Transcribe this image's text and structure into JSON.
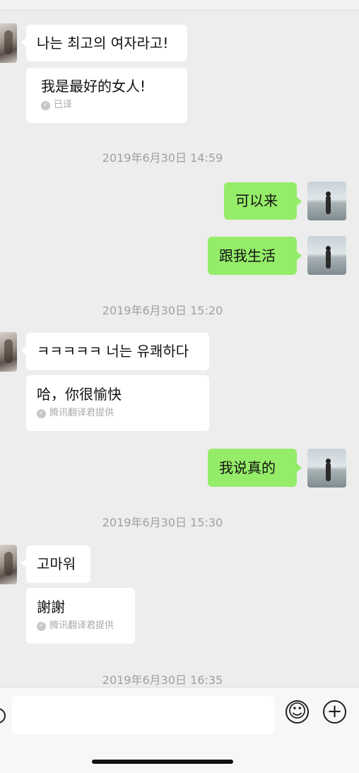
{
  "messages": [
    {
      "side": "left",
      "text": "나는 최고의 여자라고!"
    },
    {
      "side": "left",
      "text": "我是最好的女人!",
      "note": "已译"
    },
    {
      "side": "right",
      "text": "可以来"
    },
    {
      "side": "right",
      "text": "跟我生活"
    },
    {
      "side": "left",
      "text": "ㅋㅋㅋㅋㅋ 너는 유쾌하다"
    },
    {
      "side": "left",
      "text": "哈，你很愉快",
      "note": "腾讯翻译君提供"
    },
    {
      "side": "right",
      "text": "我说真的"
    },
    {
      "side": "left",
      "text": "고마워"
    },
    {
      "side": "left",
      "text": "謝謝",
      "note": "腾讯翻译君提供"
    }
  ],
  "timestamps": [
    "2019年6月30日 14:59",
    "2019年6月30日 15:20",
    "2019年6月30日 15:30",
    "2019年6月30日 16:35"
  ],
  "input_bar": {
    "placeholder": "",
    "emoji_icon": "emoji-icon",
    "add_icon": "plus-icon"
  },
  "colors": {
    "background": "#ededed",
    "sent_bubble": "#95ec69",
    "received_bubble": "#ffffff",
    "timestamp": "#a0a0a0"
  }
}
